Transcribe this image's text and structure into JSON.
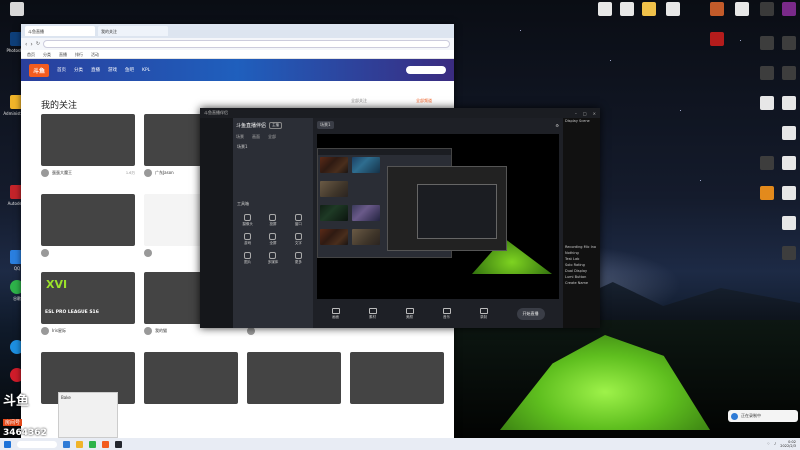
{
  "browser": {
    "tabs": [
      "斗鱼直播",
      "我的关注"
    ],
    "bookmarks": [
      "首页",
      "分类",
      "直播",
      "排行",
      "活动"
    ],
    "site_nav": [
      "首页",
      "分类",
      "直播",
      "游戏",
      "鱼吧",
      "KPL"
    ],
    "follow_title": "我的关注",
    "follow_link": "全部关注",
    "follow_link2": "全部频道",
    "cards": [
      {
        "name": "蛋蛋大魔王",
        "hot": "1.6万"
      },
      {
        "name": "广东Jason",
        "hot": "8.1万"
      },
      {
        "name": "",
        "hot": ""
      },
      {
        "name": "",
        "hot": ""
      },
      {
        "name": "",
        "hot": ""
      },
      {
        "name": "Iris星际",
        "hot": ""
      },
      {
        "name": "ESL PRO LEAGUE S16",
        "hot": ""
      },
      {
        "name": "我的猫",
        "hot": ""
      },
      {
        "name": "",
        "hot": ""
      }
    ],
    "esl_text": "ESL PRO LEAGUE S16",
    "esl_roman": "XVI"
  },
  "obs": {
    "title": "斗鱼直播伴侣",
    "panel_title": "斗鱼直播伴侣",
    "badge": "主播",
    "panel_tabs": [
      "场景",
      "画面",
      "全部"
    ],
    "scene_rows": [
      "场景1"
    ],
    "tools_label": "工具箱",
    "tools": [
      "摄像头",
      "投屏",
      "窗口",
      "游戏",
      "全屏",
      "文字",
      "图片",
      "多媒体",
      "更多"
    ],
    "bottom_buttons": [
      "画面",
      "素材",
      "美颜",
      "音乐",
      "录制"
    ],
    "start_label": "开始直播",
    "right_lines": [
      "Display Scene",
      "Recording Mic Ino",
      "Nothing",
      "Test Lab",
      "Solo Rating",
      "Dual Display",
      "Lumi Button",
      "Create Name"
    ]
  },
  "dm": {
    "header": "Bake"
  },
  "watermark": {
    "logo": "斗鱼",
    "label": "房间号",
    "room": "3464362"
  },
  "toast": {
    "text": "正在录制中"
  },
  "taskbar": {
    "time": "0:02",
    "date": "2022/2/3"
  },
  "desktop_icons": [
    "Photoshop",
    "Administrator",
    "Autodesk",
    "QQ",
    "谷歌",
    "Adobe",
    "Office",
    "AutoCAD"
  ],
  "colors": {
    "accent": "#f25c1f",
    "obs_bg": "#23262d",
    "tent": "#7ed321"
  }
}
